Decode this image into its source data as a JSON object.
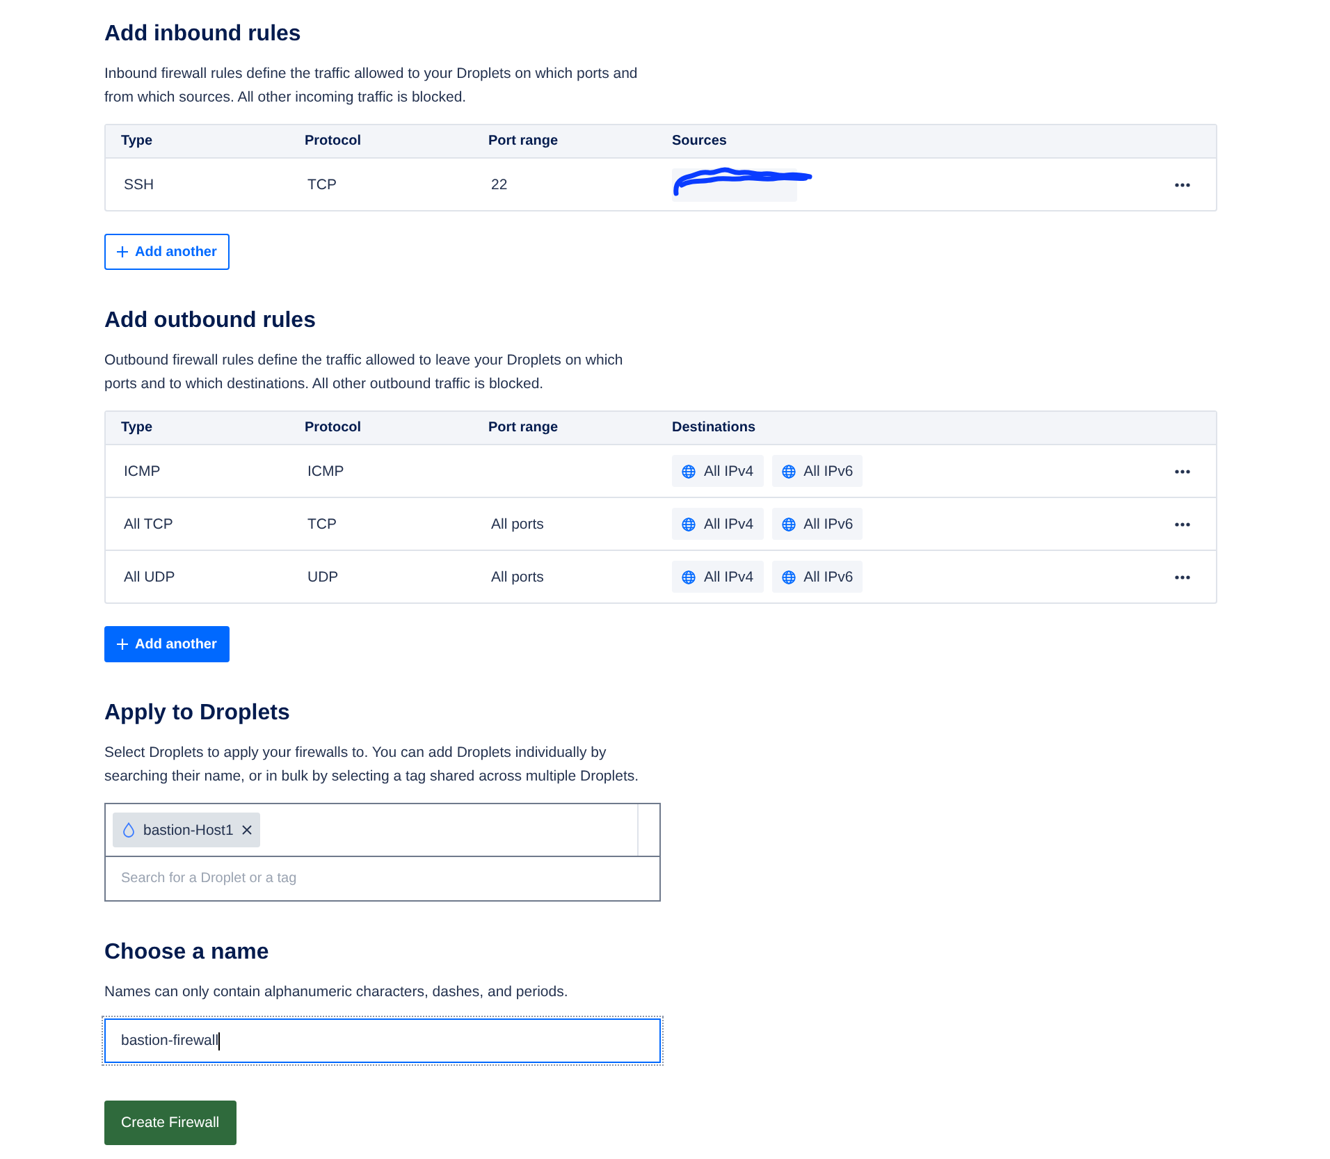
{
  "sections": [
    {
      "kind": "rules",
      "title": "Add inbound rules",
      "description": "Inbound firewall rules define the traffic allowed to your Droplets on which ports and from which sources. All other incoming traffic is blocked.",
      "table": {
        "columns": [
          "Type",
          "Protocol",
          "Port range",
          "Sources"
        ],
        "rows": [
          {
            "type": "SSH",
            "protocol": "TCP",
            "port_range": "22",
            "targets": [
              {
                "kind": "redacted"
              }
            ]
          }
        ]
      },
      "add_button": {
        "label": "Add another"
      }
    },
    {
      "kind": "rules",
      "title": "Add outbound rules",
      "description": "Outbound firewall rules define the traffic allowed to leave your Droplets on which ports and to which destinations. All other outbound traffic is blocked.",
      "table": {
        "columns": [
          "Type",
          "Protocol",
          "Port range",
          "Destinations"
        ],
        "rows": [
          {
            "type": "ICMP",
            "protocol": "ICMP",
            "targets": [
              {
                "kind": "address",
                "label": "All IPv4"
              },
              {
                "kind": "address",
                "label": "All IPv6"
              }
            ]
          },
          {
            "type": "All TCP",
            "protocol": "TCP",
            "port_range": "All ports",
            "targets": [
              {
                "kind": "address",
                "label": "All IPv4"
              },
              {
                "kind": "address",
                "label": "All IPv6"
              }
            ]
          },
          {
            "type": "All UDP",
            "protocol": "UDP",
            "port_range": "All ports",
            "targets": [
              {
                "kind": "address",
                "label": "All IPv4"
              },
              {
                "kind": "address",
                "label": "All IPv6"
              }
            ]
          }
        ]
      },
      "add_button": {
        "label": "Add another"
      }
    },
    {
      "kind": "droplets",
      "title": "Apply to Droplets",
      "description": "Select Droplets to apply your firewalls to. You can add Droplets individually by searching their name, or in bulk by selecting a tag shared across multiple Droplets.",
      "picker": {
        "chips": [
          {
            "label": "bastion-Host1"
          }
        ],
        "search": {
          "placeholder": "Search for a Droplet or a tag"
        }
      }
    },
    {
      "kind": "name",
      "title": "Choose a name",
      "description": "Names can only contain alphanumeric characters, dashes, and periods.",
      "input": {
        "value": "bastion-firewall",
        "focused": true
      }
    }
  ],
  "submit_button": {
    "label": "Create Firewall"
  }
}
